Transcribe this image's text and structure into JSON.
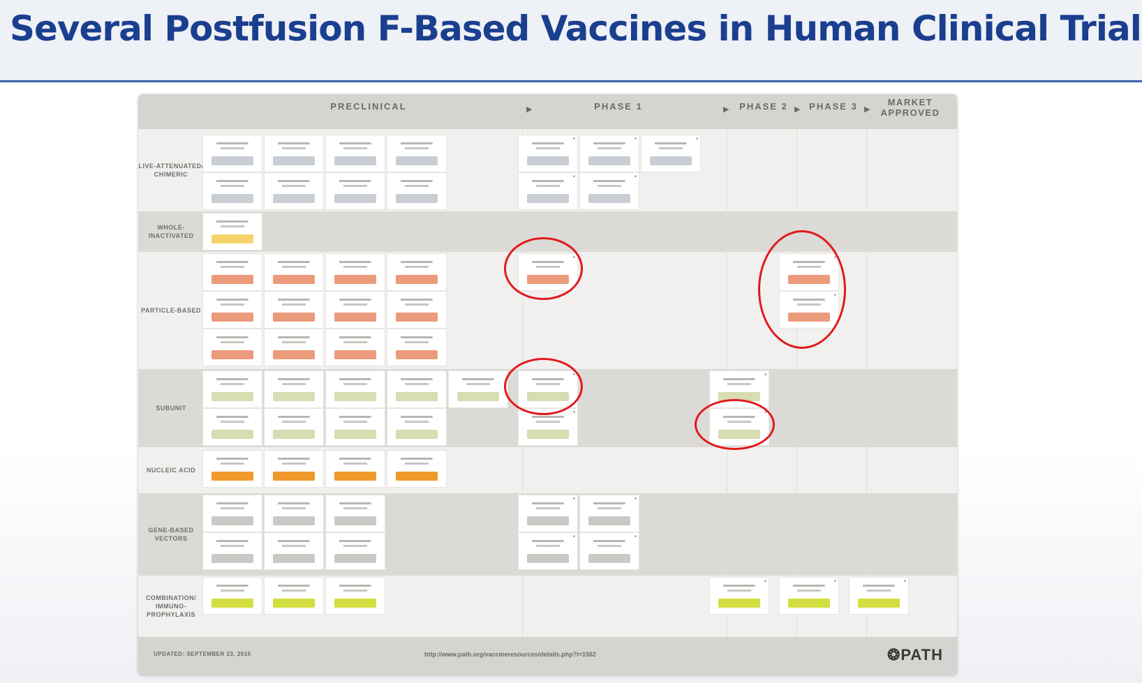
{
  "slide": {
    "title": "Several Postfusion F-Based Vaccines in Human Clinical Trials…"
  },
  "pipeline": {
    "stages": [
      {
        "label": "PRECLINICAL"
      },
      {
        "label": "PHASE 1"
      },
      {
        "label": "PHASE 2"
      },
      {
        "label": "PHASE 3"
      },
      {
        "label": "MARKET APPROVED"
      }
    ],
    "arrow_glyph": "▶",
    "rows": [
      {
        "label": "LIVE-ATTENUATED/ CHIMERIC"
      },
      {
        "label": "WHOLE-INACTIVATED"
      },
      {
        "label": "PARTICLE-BASED"
      },
      {
        "label": "SUBUNIT"
      },
      {
        "label": "NUCLEIC ACID"
      },
      {
        "label": "GENE-BASED VECTORS"
      },
      {
        "label": "COMBINATION/ IMMUNO-PROPHYLAXIS"
      }
    ],
    "footer": {
      "updated": "UPDATED: SEPTEMBER 23, 2016",
      "url": "http://www.path.org/vaccineresources/details.php?i=1562",
      "logo": "PATH",
      "logo_icon": "globe-icon"
    }
  },
  "colors": {
    "title_blue": "#1b3f8f",
    "rule_blue": "#3b63a8",
    "highlight_red": "#e0191c",
    "tag_live": "#c8ced3",
    "tag_whole": "#f7d36b",
    "tag_particle": "#ec9a7c",
    "tag_subunit": "#d7dcb1",
    "tag_nucleic": "#ef9a2b",
    "tag_gene": "#c9c9c6",
    "tag_combo": "#d2dd3f"
  }
}
